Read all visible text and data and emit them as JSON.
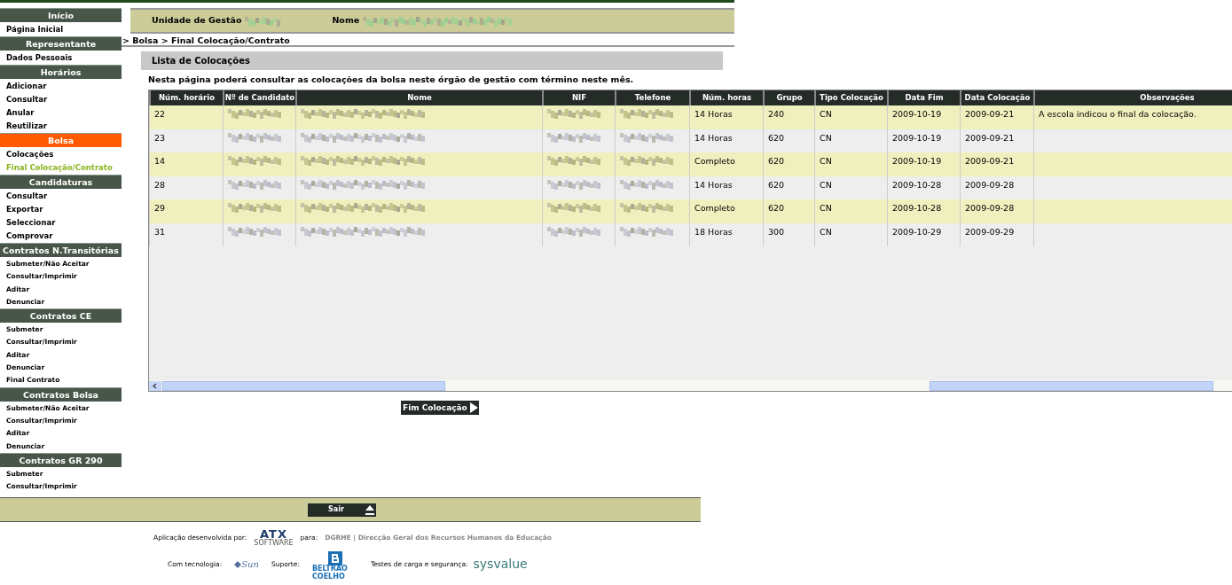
{
  "sidebar": {
    "items": [
      {
        "kind": "header",
        "label": "Início",
        "selected": false
      },
      {
        "kind": "link",
        "label": "Página Inicial",
        "selected": false
      },
      {
        "kind": "header",
        "label": "Representante",
        "selected": false
      },
      {
        "kind": "link",
        "label": "Dados Pessoais",
        "selected": false
      },
      {
        "kind": "header",
        "label": "Horários",
        "selected": false
      },
      {
        "kind": "link",
        "label": "Adicionar",
        "selected": false
      },
      {
        "kind": "link",
        "label": "Consultar",
        "selected": false
      },
      {
        "kind": "link",
        "label": "Anular",
        "selected": false
      },
      {
        "kind": "link",
        "label": "Reutilizar",
        "selected": false
      },
      {
        "kind": "header",
        "label": "Bolsa",
        "selected": true
      },
      {
        "kind": "link",
        "label": "Colocações",
        "selected": false
      },
      {
        "kind": "link",
        "label": "Final Colocação/Contrato",
        "selected": true
      },
      {
        "kind": "header",
        "label": "Candidaturas",
        "selected": false
      },
      {
        "kind": "link",
        "label": "Consultar",
        "selected": false
      },
      {
        "kind": "link",
        "label": "Exportar",
        "selected": false
      },
      {
        "kind": "link",
        "label": "Seleccionar",
        "selected": false
      },
      {
        "kind": "link",
        "label": "Comprovar",
        "selected": false
      },
      {
        "kind": "header",
        "label": "Contratos N.Transitórias",
        "selected": false
      },
      {
        "kind": "sublink",
        "label": "Submeter/Não Aceitar",
        "selected": false
      },
      {
        "kind": "sublink",
        "label": "Consultar/Imprimir",
        "selected": false
      },
      {
        "kind": "sublink",
        "label": "Aditar",
        "selected": false
      },
      {
        "kind": "sublink",
        "label": "Denunciar",
        "selected": false
      },
      {
        "kind": "header",
        "label": "Contratos CE",
        "selected": false
      },
      {
        "kind": "sublink",
        "label": "Submeter",
        "selected": false
      },
      {
        "kind": "sublink",
        "label": "Consultar/Imprimir",
        "selected": false
      },
      {
        "kind": "sublink",
        "label": "Aditar",
        "selected": false
      },
      {
        "kind": "sublink",
        "label": "Denunciar",
        "selected": false
      },
      {
        "kind": "sublink",
        "label": "Final Contrato",
        "selected": false
      },
      {
        "kind": "header",
        "label": "Contratos Bolsa",
        "selected": false
      },
      {
        "kind": "sublink",
        "label": "Submeter/Não Aceitar",
        "selected": false
      },
      {
        "kind": "sublink",
        "label": "Consultar/Imprimir",
        "selected": false
      },
      {
        "kind": "sublink",
        "label": "Aditar",
        "selected": false
      },
      {
        "kind": "sublink",
        "label": "Denunciar",
        "selected": false
      },
      {
        "kind": "header",
        "label": "Contratos GR 290",
        "selected": false
      },
      {
        "kind": "sublink",
        "label": "Submeter",
        "selected": false
      },
      {
        "kind": "sublink",
        "label": "Consultar/Imprimir",
        "selected": false
      }
    ]
  },
  "header": {
    "fields": [
      "Unidade de Gestão",
      "Nome"
    ]
  },
  "breadcrumb": "> Bolsa > Final Colocação/Contrato",
  "section_title": "Lista de Colocações",
  "intro": "Nesta página poderá consultar as colocações da bolsa neste órgão de gestão com término neste mês.",
  "table": {
    "columns": [
      "Núm. horário",
      "Nº de Candidato",
      "Nome",
      "NIF",
      "Telefone",
      "Núm. horas",
      "Grupo",
      "Tipo Colocação",
      "Data Fim",
      "Data Colocação",
      "Observações"
    ],
    "rows": [
      {
        "cells": [
          "22",
          null,
          null,
          null,
          null,
          "14 Horas",
          "240",
          "CN",
          "2009-10-19",
          "2009-09-21",
          "A escola indicou o final da colocação."
        ]
      },
      {
        "cells": [
          "23",
          null,
          null,
          null,
          null,
          "14 Horas",
          "620",
          "CN",
          "2009-10-19",
          "2009-09-21",
          ""
        ]
      },
      {
        "cells": [
          "14",
          null,
          null,
          null,
          null,
          "Completo",
          "620",
          "CN",
          "2009-10-19",
          "2009-09-21",
          ""
        ]
      },
      {
        "cells": [
          "28",
          null,
          null,
          null,
          null,
          "14 Horas",
          "620",
          "CN",
          "2009-10-28",
          "2009-09-28",
          ""
        ]
      },
      {
        "cells": [
          "29",
          null,
          null,
          null,
          null,
          "Completo",
          "620",
          "CN",
          "2009-10-28",
          "2009-09-28",
          ""
        ]
      },
      {
        "cells": [
          "31",
          null,
          null,
          null,
          null,
          "18 Horas",
          "300",
          "CN",
          "2009-10-29",
          "2009-09-29",
          ""
        ]
      }
    ]
  },
  "action_button": "Fim Colocação",
  "exit_button": "Sair",
  "credits": {
    "developed_by": "Aplicação desenvolvida por:",
    "developer_logo": "ATX",
    "developer_logo_sub": "SOFTWARE",
    "for": "para:",
    "client": "DGRHE | Direcção Geral dos Recursos Humanos da Educação",
    "technology": "Com tecnologia:",
    "tech_logo": "Sun",
    "support": "Suporte:",
    "support_logo": "BELTRÃO COELHO",
    "testing": "Testes de carga e segurança:",
    "testing_logo": "sysvalue"
  }
}
